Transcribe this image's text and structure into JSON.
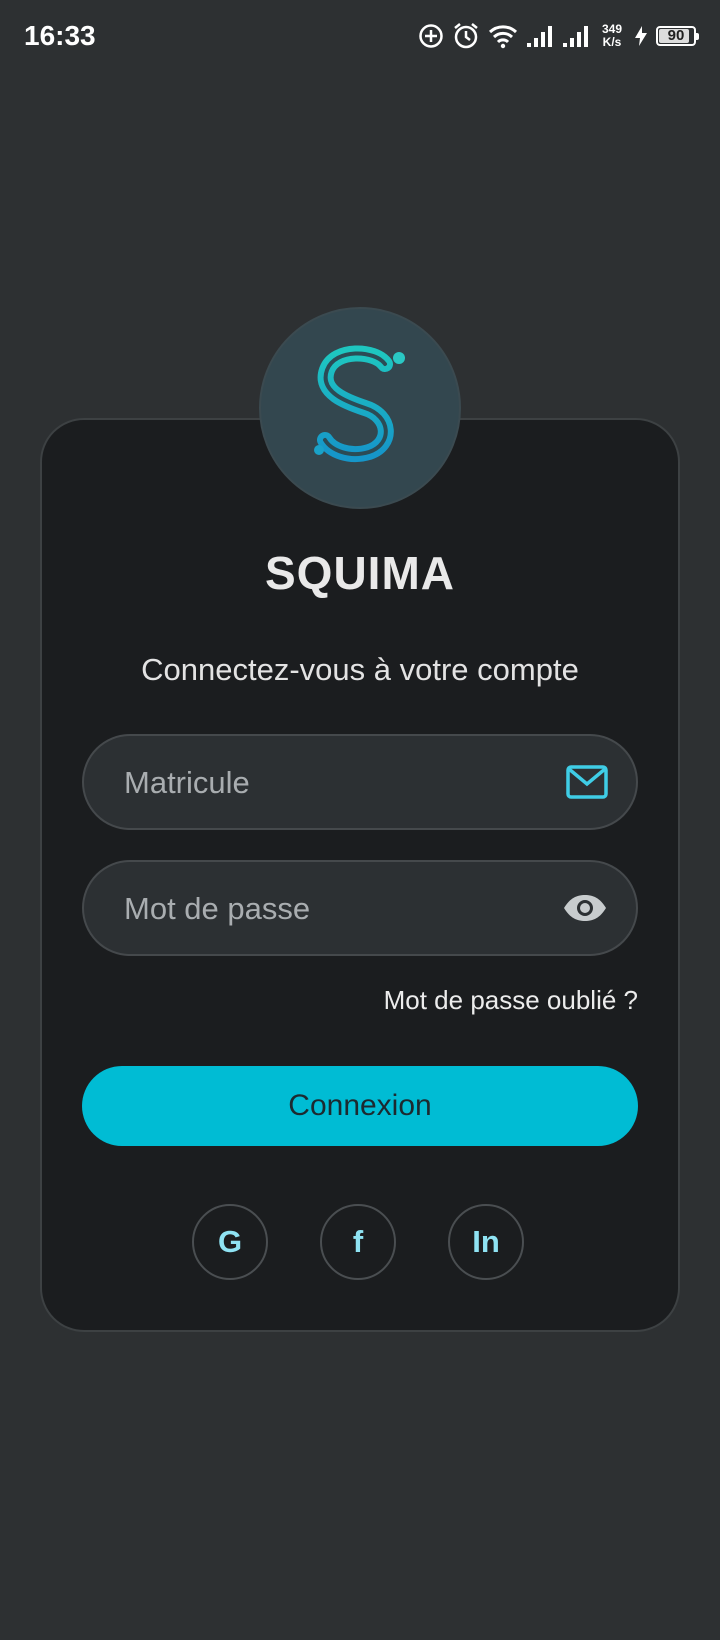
{
  "status_bar": {
    "time": "16:33",
    "net_speed_value": "349",
    "net_speed_unit": "K/s",
    "battery_level": "90",
    "battery_fraction": 0.9,
    "icons": [
      "data-saver-icon",
      "alarm-icon",
      "wifi-icon",
      "signal-icon",
      "signal-icon",
      "charging-icon",
      "battery-icon"
    ]
  },
  "app": {
    "name": "SQUIMA",
    "subtitle": "Connectez-vous à votre compte",
    "logo_icon": "s-logo-icon"
  },
  "form": {
    "matricule_placeholder": "Matricule",
    "matricule_icon": "mail-icon",
    "password_placeholder": "Mot de passe",
    "password_icon": "eye-icon",
    "forgot_password": "Mot de passe oublié ?",
    "login_label": "Connexion"
  },
  "social": {
    "google": "G",
    "facebook": "f",
    "linkedin": "In"
  },
  "colors": {
    "background": "#2d3032",
    "card": "#1b1d1f",
    "accent": "#00bcd4",
    "social_text": "#8fe3f3"
  }
}
